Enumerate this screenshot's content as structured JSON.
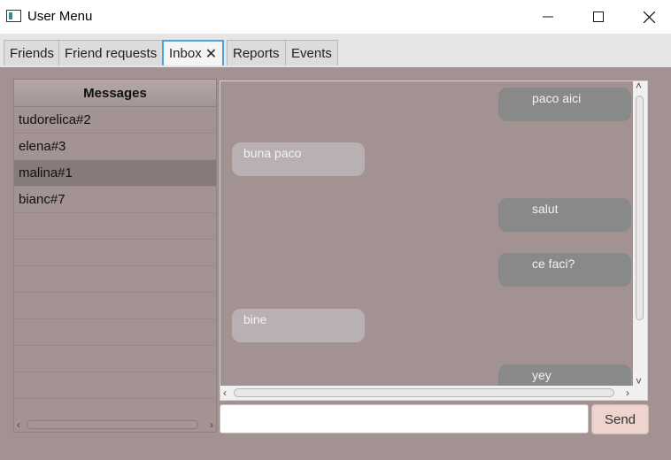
{
  "window": {
    "title": "User Menu",
    "controls": [
      "minimize-icon",
      "maximize-icon",
      "close-icon"
    ]
  },
  "tabs": [
    {
      "label": "Friends"
    },
    {
      "label": "Friend requests"
    },
    {
      "label": "Inbox",
      "active": true,
      "close_glyph": "✕"
    },
    {
      "label": "Reports"
    },
    {
      "label": "Events"
    }
  ],
  "messages_list": {
    "header": "Messages",
    "items": [
      "tudorelica#2",
      "elena#3",
      "malina#1",
      "bianc#7"
    ],
    "selected": "malina#1"
  },
  "chat": {
    "messages": [
      {
        "text": "paco aici",
        "direction": "sent"
      },
      {
        "text": "buna paco",
        "direction": "received"
      },
      {
        "text": "salut",
        "direction": "sent"
      },
      {
        "text": "ce faci?",
        "direction": "sent"
      },
      {
        "text": "bine",
        "direction": "received"
      },
      {
        "text": "yey",
        "direction": "sent"
      }
    ]
  },
  "composer": {
    "value": "",
    "send_label": "Send"
  },
  "colors": {
    "background": "#a29292",
    "sent_bubble": "#888989",
    "received_bubble": "#b9b0b3",
    "send_button": "#eed3cf",
    "active_tab_border": "#4da3df"
  }
}
